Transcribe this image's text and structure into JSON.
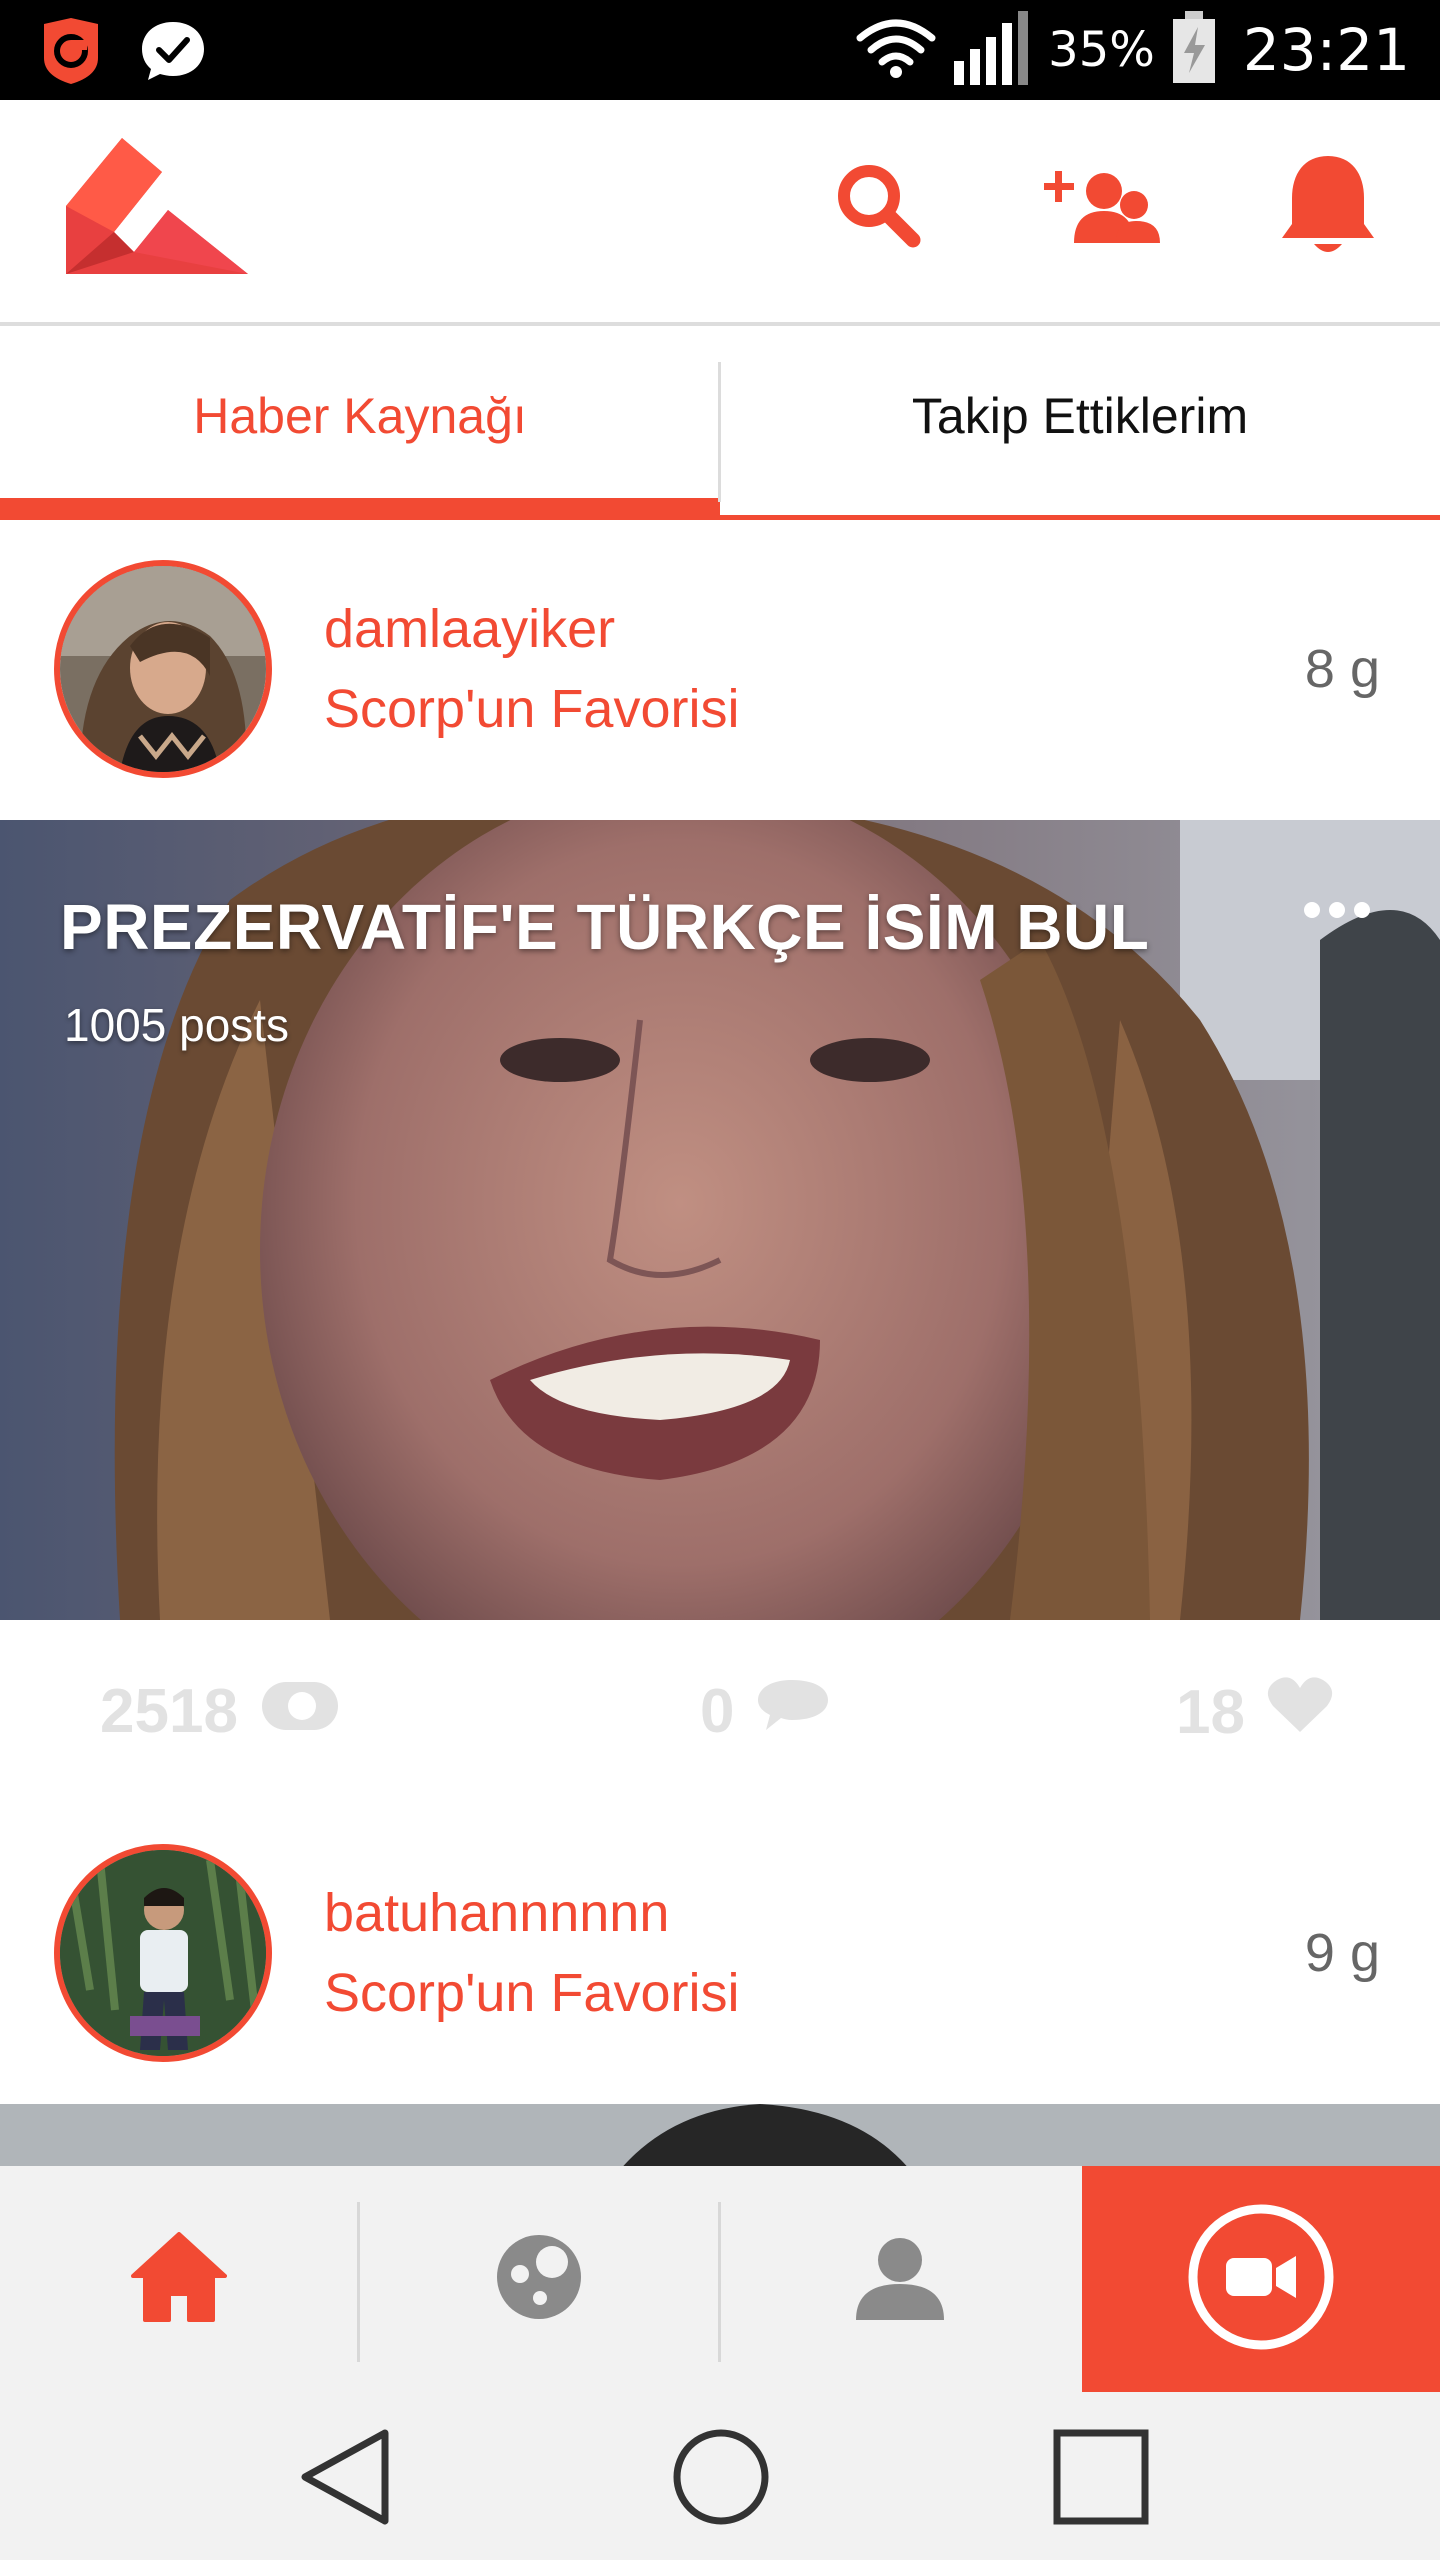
{
  "status_bar": {
    "battery_percent": "35%",
    "time": "23:21",
    "icons": [
      "shield-app-icon",
      "chat-check-app-icon",
      "wifi-icon",
      "signal-icon",
      "battery-charging-icon"
    ]
  },
  "app_bar": {
    "logo": "scorp-logo",
    "actions": [
      "search-icon",
      "add-friend-icon",
      "bell-icon"
    ]
  },
  "tabs": [
    {
      "label": "Haber Kaynağı",
      "active": true
    },
    {
      "label": "Takip Ettiklerim",
      "active": false
    }
  ],
  "posts": [
    {
      "username": "damlaayiker",
      "subtitle": "Scorp'un Favorisi",
      "time": "8 g",
      "title": "PREZERVATİF'E TÜRKÇE İSİM BUL",
      "count": "1005 posts",
      "views": "2518",
      "comments": "0",
      "likes": "18"
    },
    {
      "username": "batuhannnnnn",
      "subtitle": "Scorp'un Favorisi",
      "time": "9 g"
    }
  ],
  "bottom_nav": [
    "home-icon",
    "explore-icon",
    "profile-icon",
    "record-video-icon"
  ],
  "system_nav": [
    "back-icon",
    "home-circle-icon",
    "recents-icon"
  ],
  "colors": {
    "accent": "#f24a33",
    "stats_gray": "#e2e2e2",
    "nav_bg": "#f2f2f2"
  }
}
